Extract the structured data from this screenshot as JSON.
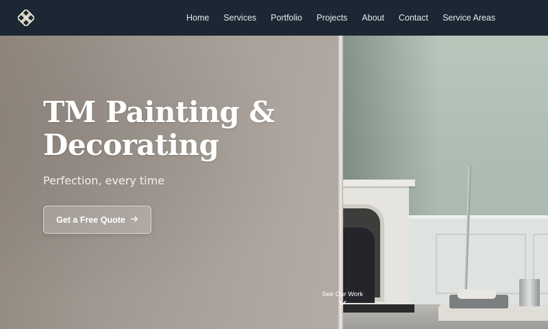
{
  "header": {
    "logo_icon": "diamond-lattice-icon",
    "nav": [
      "Home",
      "Services",
      "Portfolio",
      "Projects",
      "About",
      "Contact",
      "Service Areas"
    ]
  },
  "hero": {
    "title_line1": "TM Painting &",
    "title_line2": "Decorating",
    "subtitle": "Perfection, every time",
    "cta_label": "Get a Free Quote",
    "cta_icon": "arrow-right-icon",
    "scroll_label": "See Our Work",
    "scroll_icon": "chevron-down-icon"
  },
  "colors": {
    "navbar": "#1b2733",
    "text": "#ffffff",
    "wall_left": "#a09890",
    "wall_right": "#aebdb2"
  }
}
